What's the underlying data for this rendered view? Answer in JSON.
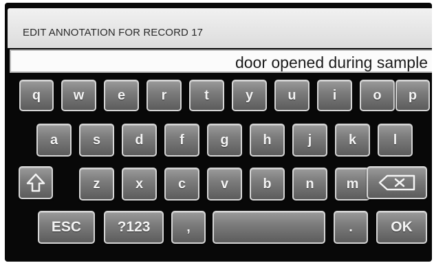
{
  "header": {
    "title": "EDIT ANNOTATION FOR RECORD 17"
  },
  "input": {
    "value": "door opened during sample"
  },
  "keyboard": {
    "row1": [
      "q",
      "w",
      "e",
      "r",
      "t",
      "y",
      "u",
      "i",
      "o",
      "p"
    ],
    "row2": [
      "a",
      "s",
      "d",
      "f",
      "g",
      "h",
      "j",
      "k",
      "l"
    ],
    "row3": [
      "z",
      "x",
      "c",
      "v",
      "b",
      "n",
      "m"
    ],
    "row4": {
      "esc": "ESC",
      "symbols": "?123",
      "comma": ",",
      "period": ".",
      "ok": "OK"
    },
    "icons": {
      "shift": "shift-arrow-icon",
      "backspace": "backspace-icon"
    }
  }
}
